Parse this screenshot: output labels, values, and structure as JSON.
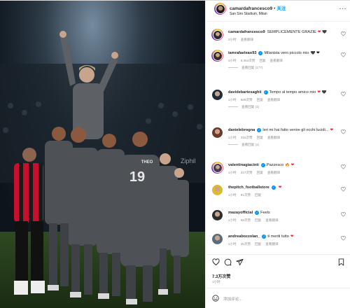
{
  "post": {
    "username": "camardafrancesco9",
    "separator": "•",
    "follow_label": "关注",
    "location": "San Siro Stadium, Milan",
    "more_label": "···",
    "photo_watermark": "Ziphil"
  },
  "comments": [
    {
      "username": "camardafrancesco9",
      "verified": false,
      "text": "SEMPLICEMENTE GRAZIE",
      "emoji": "❤ 🖤",
      "emoji_class": "heart-em",
      "time": "2小时",
      "likes": "",
      "reply_label": "",
      "translate_label": "查看翻译",
      "replies": ""
    },
    {
      "username": "iamrafaeleao93",
      "verified": true,
      "text": "Milanista vero piccolo mio",
      "emoji": "🖤 ❤",
      "emoji_class": "heart-bk",
      "time": "2小时",
      "likes": "5,454次赞",
      "reply_label": "回复",
      "translate_label": "查看翻译",
      "replies": "查看回复 (177)"
    },
    {
      "username": "davidebartesaghii",
      "verified": true,
      "text": "Tempo al tempo amico mio",
      "emoji": "❤ 🖤",
      "emoji_class": "heart-em",
      "time": "1小时",
      "likes": "589次赞",
      "reply_label": "回复",
      "translate_label": "查看翻译",
      "replies": "查看回复 (1)"
    },
    {
      "username": "danielebrogna",
      "verified": true,
      "text": "Ieri mi hai fatto venire gli occhi lucidi...",
      "emoji": "❤",
      "emoji_class": "heart-em",
      "time": "1小时",
      "likes": "315次赞",
      "reply_label": "回复",
      "translate_label": "查看翻译",
      "replies": "查看回复 (1)"
    },
    {
      "username": "valentinagiacinti",
      "verified": true,
      "text": "Pazzesco",
      "emoji": "🔥 ❤",
      "emoji_class": "heart-em",
      "time": "1小时",
      "likes": "247次赞",
      "reply_label": "回复",
      "translate_label": "查看翻译",
      "replies": ""
    },
    {
      "username": "thepitch_footballstore",
      "verified": true,
      "text": "",
      "emoji": "❤",
      "emoji_class": "heart-em",
      "time": "1小时",
      "likes": "91次赞",
      "reply_label": "回复",
      "translate_label": "",
      "replies": ""
    },
    {
      "username": "mazayofficial",
      "verified": true,
      "text": "Feels",
      "emoji": "",
      "emoji_class": "heart-em",
      "time": "1小时",
      "likes": "58次赞",
      "reply_label": "回复",
      "translate_label": "查看翻译",
      "replies": ""
    },
    {
      "username": "andreabozzolan_",
      "verified": true,
      "text": "ti meriti tutto",
      "emoji": "❤",
      "emoji_class": "heart-em",
      "time": "1小时",
      "likes": "25次赞",
      "reply_label": "回复",
      "translate_label": "查看翻译",
      "replies": ""
    }
  ],
  "footer": {
    "likes_count": "7.3万次赞",
    "post_time": "1小时",
    "comment_placeholder": "添加评论..."
  },
  "icons": {
    "like": "heart-icon",
    "comment": "comment-icon",
    "share": "share-icon",
    "save": "bookmark-icon",
    "emoji": "emoji-icon",
    "comment_like": "small-heart-icon"
  },
  "colors": {
    "accent": "#0095f6",
    "verified": "#0095f6",
    "heart": "#ed2b39",
    "muted": "#8e8e8e",
    "milan_red": "#c8102e"
  }
}
